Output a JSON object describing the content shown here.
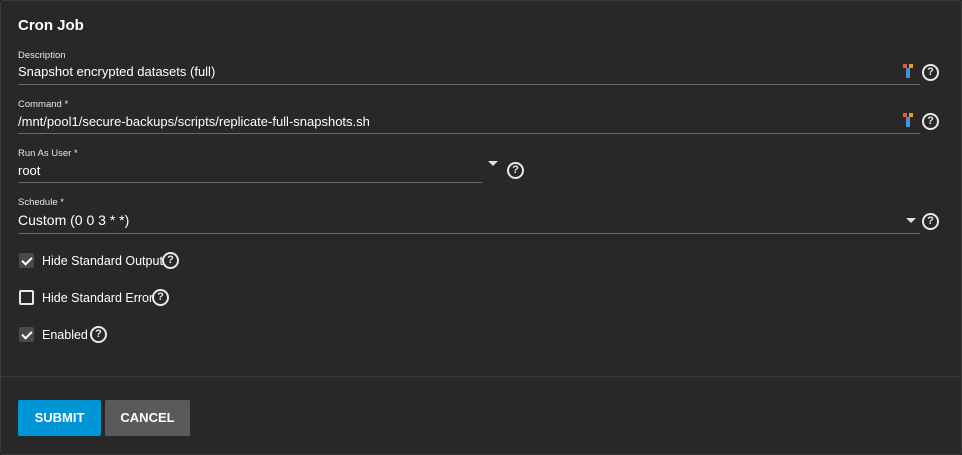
{
  "form": {
    "title": "Cron Job",
    "description": {
      "label": "Description",
      "value": "Snapshot encrypted datasets (full)"
    },
    "command": {
      "label": "Command *",
      "value": "/mnt/pool1/secure-backups/scripts/replicate-full-snapshots.sh"
    },
    "run_as_user": {
      "label": "Run As User *",
      "value": "root"
    },
    "schedule": {
      "label": "Schedule *",
      "value": "Custom (0 0 3 * *)"
    },
    "checkboxes": [
      {
        "label": "Hide Standard Output",
        "checked": true
      },
      {
        "label": "Hide Standard Error",
        "checked": false
      },
      {
        "label": "Enabled",
        "checked": true
      }
    ],
    "help_glyph": "?"
  },
  "actions": {
    "submit_label": "SUBMIT",
    "cancel_label": "CANCEL"
  },
  "colors": {
    "accent": "#0095d5",
    "cancel": "#5a5a5a",
    "background": "#282828"
  },
  "icons": {
    "help": "help-circle-icon",
    "autofill": "key-autofill-icon",
    "dropdown": "caret-down-icon",
    "check": "check-icon"
  }
}
